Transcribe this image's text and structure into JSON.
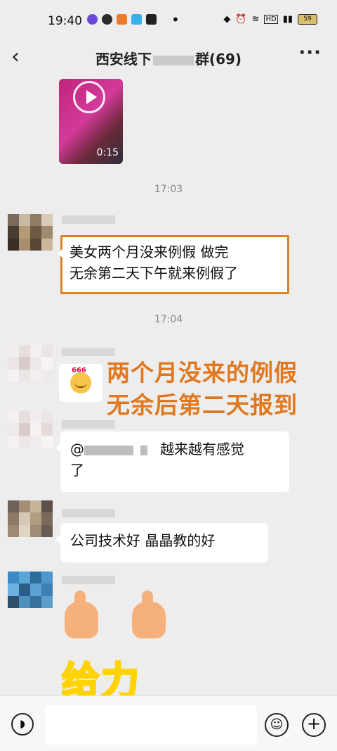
{
  "status_bar": {
    "time": "19:40",
    "battery": "59"
  },
  "header": {
    "back_icon": "chevron-left-icon",
    "title_prefix": "西安线下",
    "title_suffix": "群(69)",
    "more_icon": "more-horizontal-icon"
  },
  "messages": {
    "video": {
      "duration": "0:15"
    },
    "ts1": "17:03",
    "msg1_line1": "美女两个月没来例假  做完",
    "msg1_line2": "无余第二天下午就来例假了",
    "ts2": "17:04",
    "annotation_line1": "两个月没来的例假",
    "annotation_line2": "无余后第二天报到",
    "msg3_at": "@",
    "msg3_text": "越来越有感觉",
    "msg3_text2": "了",
    "msg4": "公司技术好  晶晶教的好",
    "sticker_text": "给力"
  },
  "input_bar": {
    "voice_icon": "voice-icon",
    "emoji_icon": "emoji-icon",
    "plus_icon": "plus-icon"
  }
}
